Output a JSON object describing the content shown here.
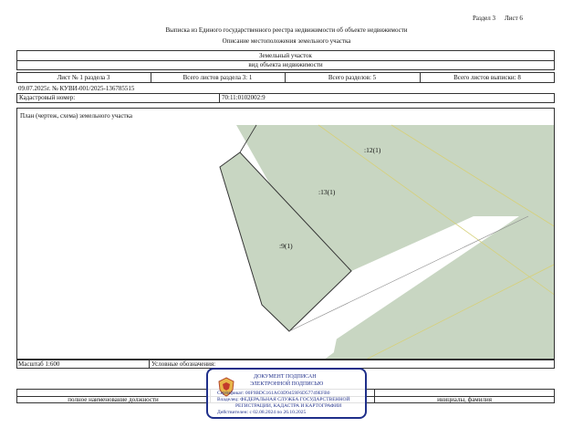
{
  "header": {
    "section_label": "Раздел 3",
    "sheet_label": "Лист 6",
    "title_line1": "Выписка из Единого государственного реестра недвижимости об объекте недвижимости",
    "title_line2": "Описание местоположения земельного участка"
  },
  "table": {
    "object_type": "Земельный участок",
    "object_type_caption": "вид объекта недвижимости",
    "sheet_no": "Лист № 1 раздела 3",
    "total_sheets_section": "Всего листов раздела 3: 1",
    "total_sections": "Всего разделов: 5",
    "total_sheets": "Всего листов выписки: 8",
    "date_number": "09.07.2025г. № КУВИ-001/2025-136785515",
    "cadastral_label": "Кадастровый номер:",
    "cadastral_value": "70:11:0102002:9",
    "plan_label": "План (чертеж, схема) земельного участка",
    "scale_label": "Масштаб 1:600",
    "legend_label": "Условные обозначения:",
    "footer_left": "полное наименование должности",
    "footer_right": "инициалы, фамилия"
  },
  "plan": {
    "parcel_labels": [
      ":9(1)",
      ":13(1)",
      ":12(1)"
    ],
    "parcel_fill": "#c8d6c2",
    "road_fill": "#ffffff"
  },
  "stamp": {
    "line1": "ДОКУМЕНТ ПОДПИСАН",
    "line2": "ЭЛЕКТРОННОЙ ПОДПИСЬЮ",
    "cert": "Сертификат: 00F9BDC161AC0D9459F6D57749EFB0",
    "owner1": "Владелец: ФЕДЕРАЛЬНАЯ СЛУЖБА ГОСУДАРСТВЕННОЙ",
    "owner2": "РЕГИСТРАЦИИ, КАДАСТРА И КАРТОГРАФИИ",
    "validity": "Действителен: с 02.08.2024 по 26.10.2025",
    "color": "#1f2f8a"
  }
}
